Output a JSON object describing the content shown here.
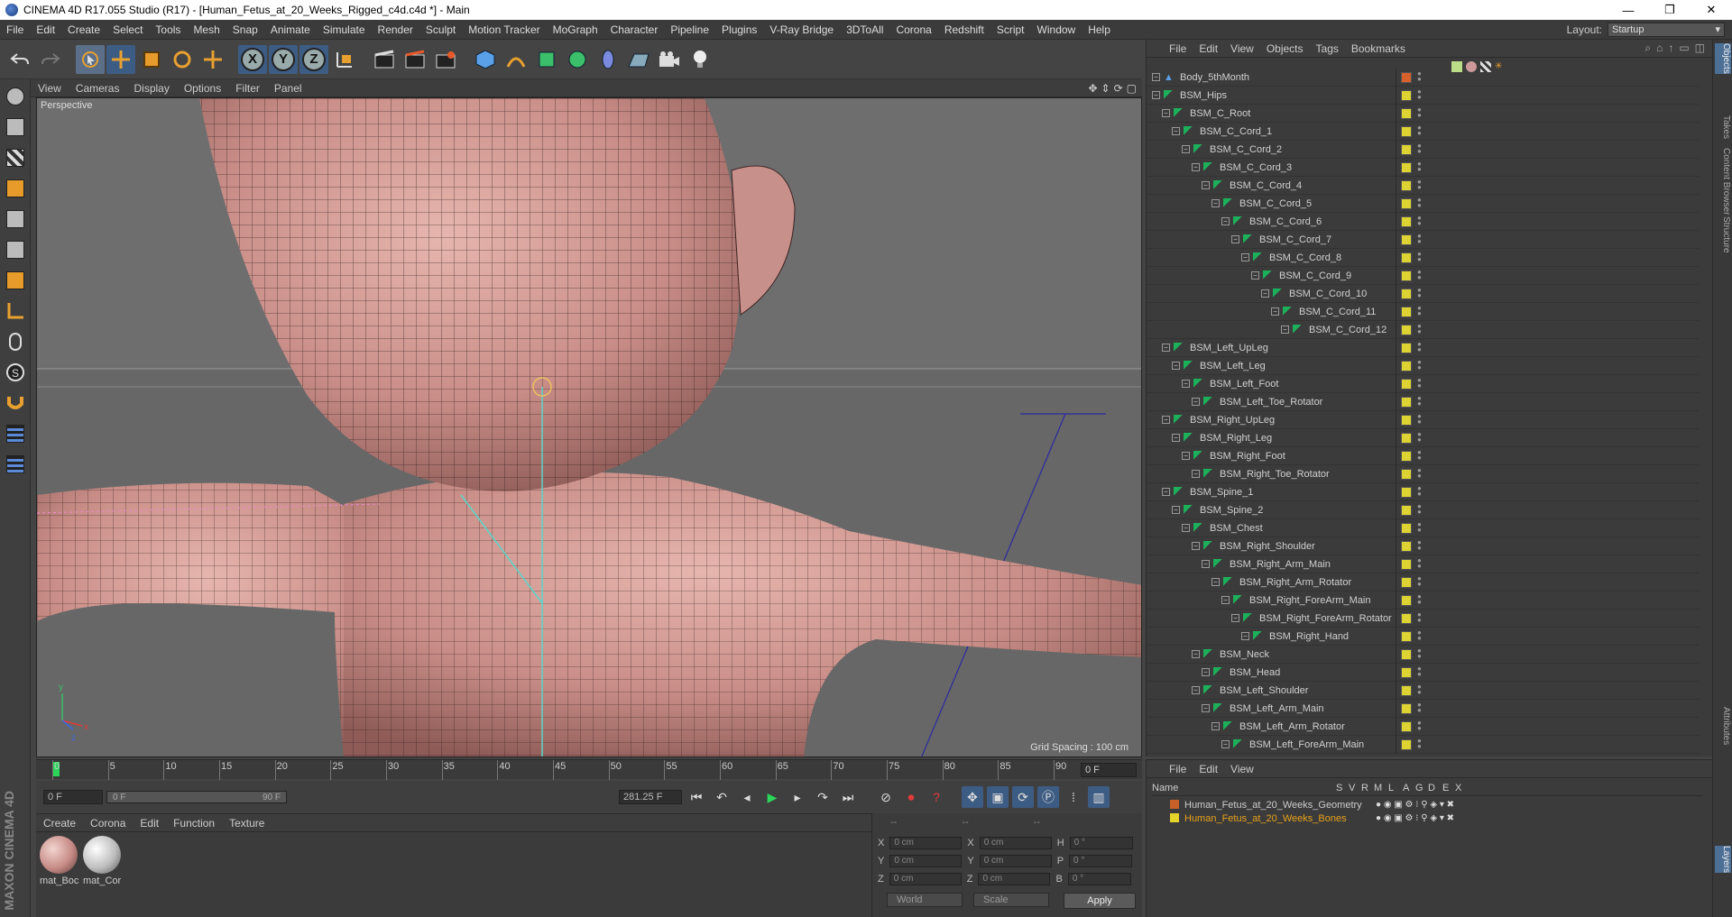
{
  "window": {
    "title": "CINEMA 4D R17.055 Studio (R17) - [Human_Fetus_at_20_Weeks_Rigged_c4d.c4d *] - Main",
    "minimize": "—",
    "restore": "❐",
    "close": "✕"
  },
  "menu": [
    "File",
    "Edit",
    "Create",
    "Select",
    "Tools",
    "Mesh",
    "Snap",
    "Animate",
    "Simulate",
    "Render",
    "Sculpt",
    "Motion Tracker",
    "MoGraph",
    "Character",
    "Pipeline",
    "Plugins",
    "V-Ray Bridge",
    "3DToAll",
    "Corona",
    "Redshift",
    "Script",
    "Window",
    "Help"
  ],
  "layout": {
    "label": "Layout:",
    "value": "Startup"
  },
  "viewport": {
    "menu": [
      "View",
      "Cameras",
      "Display",
      "Options",
      "Filter",
      "Panel"
    ],
    "camera_label": "Perspective",
    "grid_spacing": "Grid Spacing : 100 cm",
    "axis_x": "x",
    "axis_y": "y",
    "axis_z": "z"
  },
  "timeline": {
    "ticks": [
      "0",
      "5",
      "10",
      "15",
      "20",
      "25",
      "30",
      "35",
      "40",
      "45",
      "50",
      "55",
      "60",
      "65",
      "70",
      "75",
      "80",
      "85",
      "90"
    ],
    "current_frame": "0 F"
  },
  "transport": {
    "start": "0 F",
    "range_start": "0 F",
    "range_end": "90 F",
    "end": "281.25 F"
  },
  "material_manager": {
    "menu": [
      "Create",
      "Corona",
      "Edit",
      "Function",
      "Texture"
    ],
    "materials": [
      {
        "label": "mat_Boc",
        "color": "#c78b86"
      },
      {
        "label": "mat_Cor",
        "color": "#bdbdbd"
      }
    ]
  },
  "coordinates": {
    "header": [
      "--",
      "--",
      "--"
    ],
    "rows": [
      {
        "a": "X",
        "av": "0 cm",
        "b": "X",
        "bv": "0 cm",
        "c": "H",
        "cv": "0 °"
      },
      {
        "a": "Y",
        "av": "0 cm",
        "b": "Y",
        "bv": "0 cm",
        "c": "P",
        "cv": "0 °"
      },
      {
        "a": "Z",
        "av": "0 cm",
        "b": "Z",
        "bv": "0 cm",
        "c": "B",
        "cv": "0 °"
      }
    ],
    "mode_world": "World",
    "mode_scale": "Scale",
    "apply": "Apply"
  },
  "object_manager": {
    "menu": [
      "File",
      "Edit",
      "View",
      "Objects",
      "Tags",
      "Bookmarks"
    ],
    "objects": [
      {
        "name": "Body_5thMonth",
        "depth": 0,
        "tag": "orange"
      },
      {
        "name": "BSM_Hips",
        "depth": 0,
        "tag": "yellow"
      },
      {
        "name": "BSM_C_Root",
        "depth": 1,
        "tag": "yellow"
      },
      {
        "name": "BSM_C_Cord_1",
        "depth": 2,
        "tag": "yellow"
      },
      {
        "name": "BSM_C_Cord_2",
        "depth": 3,
        "tag": "yellow"
      },
      {
        "name": "BSM_C_Cord_3",
        "depth": 4,
        "tag": "yellow"
      },
      {
        "name": "BSM_C_Cord_4",
        "depth": 5,
        "tag": "yellow"
      },
      {
        "name": "BSM_C_Cord_5",
        "depth": 6,
        "tag": "yellow"
      },
      {
        "name": "BSM_C_Cord_6",
        "depth": 7,
        "tag": "yellow"
      },
      {
        "name": "BSM_C_Cord_7",
        "depth": 8,
        "tag": "yellow"
      },
      {
        "name": "BSM_C_Cord_8",
        "depth": 9,
        "tag": "yellow"
      },
      {
        "name": "BSM_C_Cord_9",
        "depth": 10,
        "tag": "yellow"
      },
      {
        "name": "BSM_C_Cord_10",
        "depth": 11,
        "tag": "yellow"
      },
      {
        "name": "BSM_C_Cord_11",
        "depth": 12,
        "tag": "yellow"
      },
      {
        "name": "BSM_C_Cord_12",
        "depth": 13,
        "tag": "yellow"
      },
      {
        "name": "BSM_Left_UpLeg",
        "depth": 1,
        "tag": "yellow"
      },
      {
        "name": "BSM_Left_Leg",
        "depth": 2,
        "tag": "yellow"
      },
      {
        "name": "BSM_Left_Foot",
        "depth": 3,
        "tag": "yellow"
      },
      {
        "name": "BSM_Left_Toe_Rotator",
        "depth": 4,
        "tag": "yellow"
      },
      {
        "name": "BSM_Right_UpLeg",
        "depth": 1,
        "tag": "yellow"
      },
      {
        "name": "BSM_Right_Leg",
        "depth": 2,
        "tag": "yellow"
      },
      {
        "name": "BSM_Right_Foot",
        "depth": 3,
        "tag": "yellow"
      },
      {
        "name": "BSM_Right_Toe_Rotator",
        "depth": 4,
        "tag": "yellow"
      },
      {
        "name": "BSM_Spine_1",
        "depth": 1,
        "tag": "yellow"
      },
      {
        "name": "BSM_Spine_2",
        "depth": 2,
        "tag": "yellow"
      },
      {
        "name": "BSM_Chest",
        "depth": 3,
        "tag": "yellow"
      },
      {
        "name": "BSM_Right_Shoulder",
        "depth": 4,
        "tag": "yellow"
      },
      {
        "name": "BSM_Right_Arm_Main",
        "depth": 5,
        "tag": "yellow"
      },
      {
        "name": "BSM_Right_Arm_Rotator",
        "depth": 6,
        "tag": "yellow"
      },
      {
        "name": "BSM_Right_ForeArm_Main",
        "depth": 7,
        "tag": "yellow"
      },
      {
        "name": "BSM_Right_ForeArm_Rotator",
        "depth": 8,
        "tag": "yellow"
      },
      {
        "name": "BSM_Right_Hand",
        "depth": 9,
        "tag": "yellow"
      },
      {
        "name": "BSM_Neck",
        "depth": 4,
        "tag": "yellow"
      },
      {
        "name": "BSM_Head",
        "depth": 5,
        "tag": "yellow"
      },
      {
        "name": "BSM_Left_Shoulder",
        "depth": 4,
        "tag": "yellow"
      },
      {
        "name": "BSM_Left_Arm_Main",
        "depth": 5,
        "tag": "yellow"
      },
      {
        "name": "BSM_Left_Arm_Rotator",
        "depth": 6,
        "tag": "yellow"
      },
      {
        "name": "BSM_Left_ForeArm_Main",
        "depth": 7,
        "tag": "yellow"
      }
    ]
  },
  "layer_manager": {
    "menu": [
      "File",
      "Edit",
      "View"
    ],
    "columns": [
      "Name",
      "S",
      "V",
      "R",
      "M",
      "L",
      "A",
      "G",
      "D",
      "E",
      "X"
    ],
    "layers": [
      {
        "name": "Human_Fetus_at_20_Weeks_Geometry",
        "color": "#c8602a",
        "text": "#cccccc"
      },
      {
        "name": "Human_Fetus_at_20_Weeks_Bones",
        "color": "#e5d52a",
        "text": "#e8a21a"
      }
    ]
  },
  "side_tabs": [
    "Objects",
    "Takes",
    "Content Browser",
    "Structure",
    "Attributes",
    "Layers"
  ],
  "brand": "MAXON CINEMA 4D"
}
